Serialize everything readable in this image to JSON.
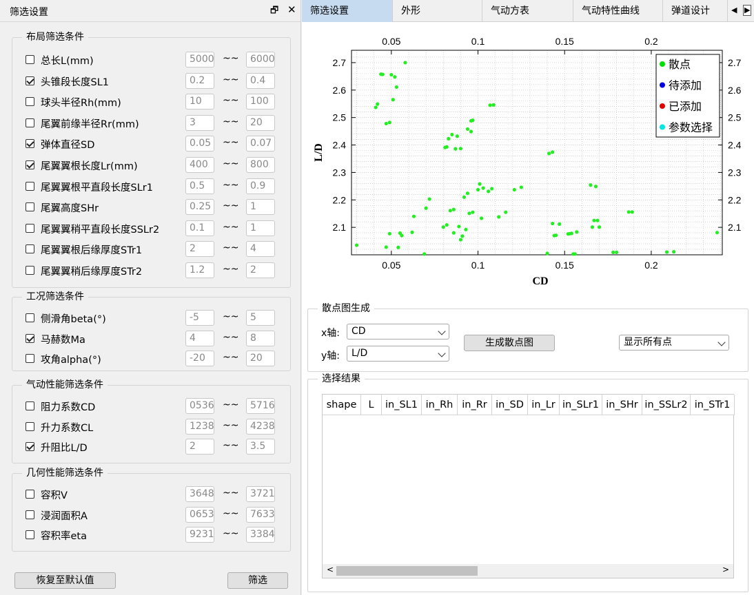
{
  "panel": {
    "title": "筛选设置",
    "float_icon": "float-icon",
    "close_icon": "close-icon"
  },
  "layout_group": {
    "title": "布局筛选条件",
    "items": [
      {
        "label": "总长L(mm)",
        "checked": false,
        "min": "5000",
        "max": "6000"
      },
      {
        "label": "头锥段长度SL1",
        "checked": true,
        "min": "0.2",
        "max": "0.4"
      },
      {
        "label": "球头半径Rh(mm)",
        "checked": false,
        "min": "10",
        "max": "100"
      },
      {
        "label": "尾翼前缘半径Rr(mm)",
        "checked": false,
        "min": "3",
        "max": "20"
      },
      {
        "label": "弹体直径SD",
        "checked": true,
        "min": "0.05",
        "max": "0.07"
      },
      {
        "label": "尾翼翼根长度Lr(mm)",
        "checked": true,
        "min": "400",
        "max": "800"
      },
      {
        "label": "尾翼翼根平直段长度SLr1",
        "checked": false,
        "min": "0.5",
        "max": "0.9"
      },
      {
        "label": "尾翼高度SHr",
        "checked": false,
        "min": "0.25",
        "max": "1"
      },
      {
        "label": "尾翼翼稍平直段长度SSLr2",
        "checked": false,
        "min": "0.1",
        "max": "1"
      },
      {
        "label": "尾翼翼根后缘厚度STr1",
        "checked": false,
        "min": "2",
        "max": "4"
      },
      {
        "label": "尾翼翼稍后缘厚度STr2",
        "checked": false,
        "min": "1.2",
        "max": "2"
      }
    ]
  },
  "condition_group": {
    "title": "工况筛选条件",
    "items": [
      {
        "label": "侧滑角beta(°)",
        "checked": false,
        "min": "-5",
        "max": "5"
      },
      {
        "label": "马赫数Ma",
        "checked": true,
        "min": "4",
        "max": "8"
      },
      {
        "label": "攻角alpha(°)",
        "checked": false,
        "min": "-20",
        "max": "20"
      }
    ]
  },
  "aero_group": {
    "title": "气动性能筛选条件",
    "items": [
      {
        "label": "阻力系数CD",
        "checked": false,
        "min": "0536",
        "max": "5716"
      },
      {
        "label": "升力系数CL",
        "checked": false,
        "min": "1238",
        "max": "4238"
      },
      {
        "label": "升阻比L/D",
        "checked": true,
        "min": "2",
        "max": "3.5"
      }
    ]
  },
  "geo_group": {
    "title": "几何性能筛选条件",
    "items": [
      {
        "label": "容积V",
        "checked": false,
        "min": "3648",
        "max": "3721"
      },
      {
        "label": "浸润面积A",
        "checked": false,
        "min": "0653",
        "max": "7633"
      },
      {
        "label": "容积率eta",
        "checked": false,
        "min": "9231",
        "max": "3384"
      }
    ]
  },
  "buttons": {
    "reset": "恢复至默认值",
    "filter": "筛选"
  },
  "tabs": [
    "筛选设置",
    "外形",
    "气动方表",
    "气动特性曲线",
    "弹道设计"
  ],
  "scatter_gen": {
    "title": "散点图生成",
    "x_label": "x轴:",
    "y_label": "y轴:",
    "x_value": "CD",
    "y_value": "L/D",
    "generate_button": "生成散点图",
    "display_mode": "显示所有点"
  },
  "results": {
    "title": "选择结果",
    "columns": [
      "shape",
      "L",
      "in_SL1",
      "in_Rh",
      "in_Rr",
      "in_SD",
      "in_Lr",
      "in_SLr1",
      "in_SHr",
      "in_SSLr2",
      "in_STr1"
    ]
  },
  "chart_data": {
    "type": "scatter",
    "xlabel": "CD",
    "ylabel": "L/D",
    "xlim": [
      0.027,
      0.241
    ],
    "ylim": [
      2.0,
      2.745
    ],
    "x_ticks": [
      "0.05",
      "0.1",
      "0.15",
      "0.2"
    ],
    "x_tick_values": [
      0.05,
      0.1,
      0.15,
      0.2
    ],
    "y_ticks": [
      "2.1",
      "2.2",
      "2.3",
      "2.4",
      "2.5",
      "2.6",
      "2.7"
    ],
    "y_tick_values": [
      2.1,
      2.2,
      2.3,
      2.4,
      2.5,
      2.6,
      2.7
    ],
    "grid": true,
    "legend_position": "top-right",
    "legend": [
      {
        "name": "散点",
        "color": "#00e000"
      },
      {
        "name": "待添加",
        "color": "#0000e0"
      },
      {
        "name": "已添加",
        "color": "#e00000"
      },
      {
        "name": "参数选择",
        "color": "#00e5e5"
      }
    ],
    "series": [
      {
        "name": "散点",
        "color": "#22ee22",
        "points": [
          [
            0.03,
            2.035
          ],
          [
            0.041,
            2.537
          ],
          [
            0.042,
            2.549
          ],
          [
            0.044,
            2.658
          ],
          [
            0.045,
            2.657
          ],
          [
            0.047,
            2.478
          ],
          [
            0.047,
            2.028
          ],
          [
            0.049,
            2.482
          ],
          [
            0.049,
            2.077
          ],
          [
            0.05,
            2.656
          ],
          [
            0.051,
            2.565
          ],
          [
            0.052,
            2.648
          ],
          [
            0.053,
            2.611
          ],
          [
            0.054,
            2.027
          ],
          [
            0.055,
            2.079
          ],
          [
            0.056,
            2.07
          ],
          [
            0.058,
            2.7
          ],
          [
            0.062,
            2.082
          ],
          [
            0.063,
            2.14
          ],
          [
            0.069,
            2.003
          ],
          [
            0.07,
            2.17
          ],
          [
            0.072,
            2.203
          ],
          [
            0.08,
            2.101
          ],
          [
            0.081,
            2.391
          ],
          [
            0.082,
            2.393
          ],
          [
            0.082,
            2.109
          ],
          [
            0.083,
            2.423
          ],
          [
            0.084,
            2.161
          ],
          [
            0.085,
            2.438
          ],
          [
            0.086,
            2.165
          ],
          [
            0.086,
            2.08
          ],
          [
            0.087,
            2.386
          ],
          [
            0.088,
            2.432
          ],
          [
            0.089,
            2.103
          ],
          [
            0.09,
            2.387
          ],
          [
            0.09,
            2.055
          ],
          [
            0.091,
            2.068
          ],
          [
            0.092,
            2.21
          ],
          [
            0.093,
            2.092
          ],
          [
            0.094,
            2.224
          ],
          [
            0.094,
            2.458
          ],
          [
            0.095,
            2.151
          ],
          [
            0.096,
            2.488
          ],
          [
            0.096,
            2.449
          ],
          [
            0.097,
            2.49
          ],
          [
            0.097,
            2.155
          ],
          [
            0.1,
            2.237
          ],
          [
            0.101,
            2.258
          ],
          [
            0.102,
            2.133
          ],
          [
            0.103,
            2.243
          ],
          [
            0.106,
            2.231
          ],
          [
            0.107,
            2.545
          ],
          [
            0.108,
            2.241
          ],
          [
            0.109,
            2.546
          ],
          [
            0.112,
            2.138
          ],
          [
            0.116,
            2.155
          ],
          [
            0.121,
            2.237
          ],
          [
            0.125,
            2.246
          ],
          [
            0.14,
            2.005
          ],
          [
            0.141,
            2.369
          ],
          [
            0.143,
            2.374
          ],
          [
            0.143,
            2.114
          ],
          [
            0.144,
            2.07
          ],
          [
            0.145,
            2.071
          ],
          [
            0.147,
            2.112
          ],
          [
            0.152,
            2.076
          ],
          [
            0.153,
            2.077
          ],
          [
            0.154,
            2.078
          ],
          [
            0.155,
            2.003
          ],
          [
            0.156,
            2.003
          ],
          [
            0.157,
            2.083
          ],
          [
            0.165,
            2.254
          ],
          [
            0.166,
            2.101
          ],
          [
            0.167,
            2.125
          ],
          [
            0.168,
            2.249
          ],
          [
            0.169,
            2.125
          ],
          [
            0.17,
            2.101
          ],
          [
            0.178,
            2.009
          ],
          [
            0.18,
            2.009
          ],
          [
            0.187,
            2.156
          ],
          [
            0.189,
            2.156
          ],
          [
            0.209,
            2.01
          ],
          [
            0.213,
            2.011
          ],
          [
            0.238,
            2.081
          ]
        ]
      }
    ]
  }
}
